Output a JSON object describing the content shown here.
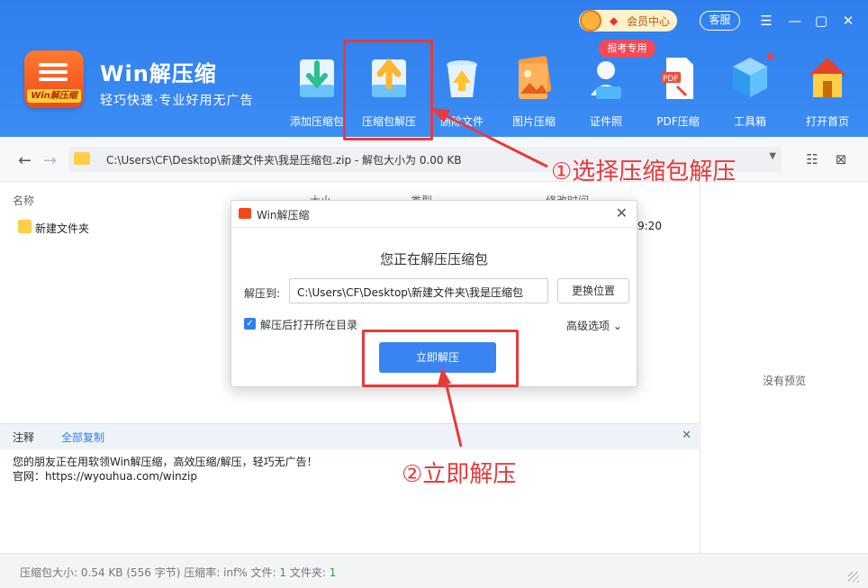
{
  "app": {
    "title": "Win解压缩",
    "slogan": "轻巧快速·专业好用无广告",
    "logo_label": "Win解压缩",
    "vip": "会员中心",
    "service": "客服",
    "badge": "报考专用"
  },
  "toolbar": [
    {
      "label": "添加压缩包",
      "icon": "add-archive-icon"
    },
    {
      "label": "压缩包解压",
      "icon": "extract-archive-icon"
    },
    {
      "label": "删除文件",
      "icon": "delete-file-icon"
    },
    {
      "label": "图片压缩",
      "icon": "image-compress-icon"
    },
    {
      "label": "证件照",
      "icon": "id-photo-icon"
    },
    {
      "label": "PDF压缩",
      "icon": "pdf-compress-icon"
    },
    {
      "label": "工具箱",
      "icon": "toolbox-icon"
    },
    {
      "label": "打开首页",
      "icon": "home-icon"
    }
  ],
  "address": {
    "path": "C:\\Users\\CF\\Desktop\\新建文件夹\\我是压缩包.zip - 解包大小为 0.00 KB"
  },
  "columns": {
    "name": "名称",
    "size": "大小",
    "type": "类型",
    "modified": "修改时间"
  },
  "files": [
    {
      "name": "新建文件夹",
      "time": "9:20"
    }
  ],
  "preview": {
    "empty": "没有预览"
  },
  "comment": {
    "header": "注释",
    "copy_all": "全部复制",
    "line1": "您的朋友正在用软领Win解压缩，高效压缩/解压，轻巧无广告！",
    "line2": "官网：https://wyouhua.com/winzip"
  },
  "status": {
    "archive_size_label": "压缩包大小:",
    "archive_size": "0.54 KB (556 字节)",
    "ratio_label": "压缩率:",
    "ratio": "inf%",
    "files_label": "文件:",
    "files": "1",
    "folders_label": "文件夹:",
    "folders": "1"
  },
  "dialog": {
    "title": "Win解压缩",
    "heading": "您正在解压压缩包",
    "extract_to_label": "解压到:",
    "extract_to_value": "C:\\Users\\CF\\Desktop\\新建文件夹\\我是压缩包",
    "change_location": "更换位置",
    "open_after_label": "解压后打开所在目录",
    "open_after_checked": true,
    "advanced": "高级选项",
    "extract_now": "立即解压"
  },
  "annotations": {
    "step1": "①选择压缩包解压",
    "step2": "②立即解压"
  },
  "colors": {
    "header": "#3c8cf4",
    "accent": "#2f7fee",
    "annotation": "#e83a3a"
  }
}
